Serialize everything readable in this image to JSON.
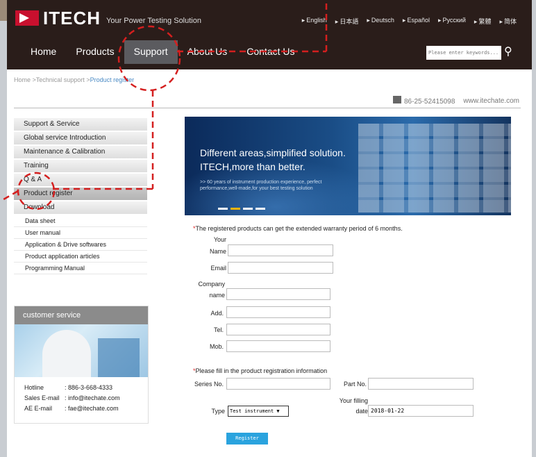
{
  "header": {
    "logo_text": "ITECH",
    "tagline": "Your Power Testing Solution",
    "languages": [
      "English",
      "日本語",
      "Deutsch",
      "Español",
      "Русский",
      "繁體",
      "简体"
    ],
    "nav": [
      "Home",
      "Products",
      "Support",
      "About Us",
      "Contact Us"
    ],
    "search_placeholder": "Please enter keywords..."
  },
  "breadcrumb": {
    "path": "Home >Technical support >",
    "current": "Product register"
  },
  "contact": {
    "phone": "86-25-52415098",
    "site": "www.itechate.com"
  },
  "sidebar": {
    "main": [
      "Support & Service",
      "Global service Introduction",
      "Maintenance & Calibration",
      "Training",
      "Q & A",
      "Product register",
      "Download"
    ],
    "sub": [
      "Data sheet",
      "User manual",
      "Application & Drive softwares",
      "Product application articles",
      "Programming Manual"
    ]
  },
  "customer_service": {
    "title": "customer service",
    "rows": [
      {
        "k": "Hotline",
        "v": ": 886-3-668-4333"
      },
      {
        "k": "Sales E-mail",
        "v": ": info@itechate.com"
      },
      {
        "k": "AE E-mail",
        "v": ": fae@itechate.com"
      }
    ]
  },
  "banner": {
    "line1": "Different areas,simplified solution.",
    "line2": "ITECH,more than better.",
    "line3": ">> 60 years of instrument production experience, perfect performance,well-made,for your best testing solution"
  },
  "form": {
    "note1": "The registered products can get the extended warranty period of 6 months.",
    "your": "Your",
    "name": "Name",
    "email": "Email",
    "company": "Company",
    "company_name": "name",
    "add": "Add.",
    "tel": "Tel.",
    "mob": "Mob.",
    "note2": "Please fill in the product registration information",
    "series": "Series No.",
    "part": "Part No.",
    "filling1": "Your filling",
    "filling2": "date",
    "date_value": "2018-01-22",
    "type": "Type",
    "type_value": "Test instrument ▼",
    "register": "Register"
  }
}
